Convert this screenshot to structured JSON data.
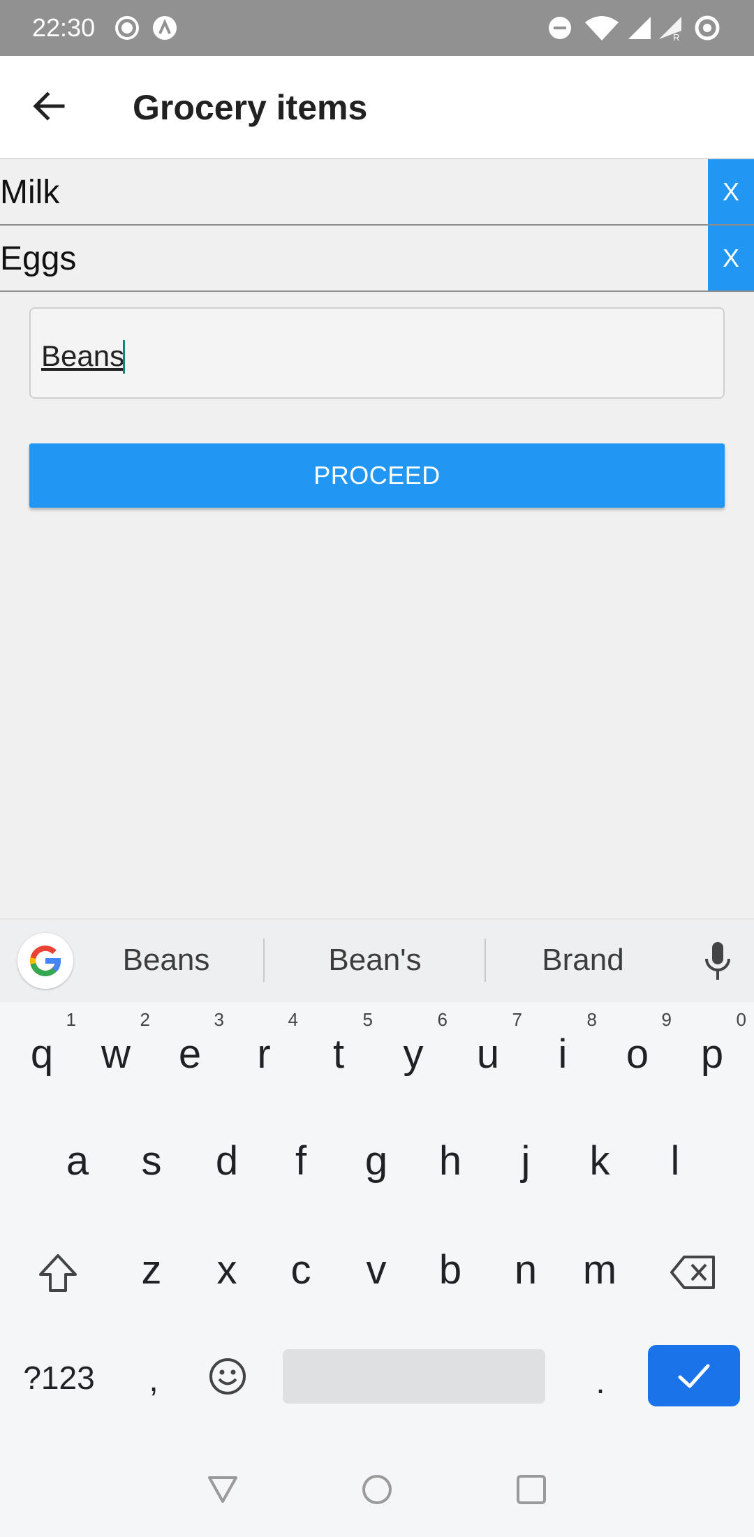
{
  "status_bar": {
    "time": "22:30",
    "icons": [
      "record-icon",
      "a-badge-icon",
      "dnd-icon",
      "wifi-icon",
      "signal-icon",
      "signal-roaming-icon",
      "ring-icon"
    ]
  },
  "app_bar": {
    "back_icon": "arrow-left-icon",
    "title": "Grocery items"
  },
  "list": {
    "items": [
      {
        "label": "Milk",
        "delete_label": "X"
      },
      {
        "label": "Eggs",
        "delete_label": "X"
      }
    ]
  },
  "input": {
    "value": "Beans"
  },
  "proceed_label": "PROCEED",
  "colors": {
    "accent": "#2196f3",
    "keyboard_enter": "#1a73e8",
    "status_bar": "#919191"
  },
  "keyboard": {
    "suggestions": [
      "Beans",
      "Bean's",
      "Brand"
    ],
    "row1": [
      {
        "key": "q",
        "num": "1"
      },
      {
        "key": "w",
        "num": "2"
      },
      {
        "key": "e",
        "num": "3"
      },
      {
        "key": "r",
        "num": "4"
      },
      {
        "key": "t",
        "num": "5"
      },
      {
        "key": "y",
        "num": "6"
      },
      {
        "key": "u",
        "num": "7"
      },
      {
        "key": "i",
        "num": "8"
      },
      {
        "key": "o",
        "num": "9"
      },
      {
        "key": "p",
        "num": "0"
      }
    ],
    "row2": [
      "a",
      "s",
      "d",
      "f",
      "g",
      "h",
      "j",
      "k",
      "l"
    ],
    "row3": [
      "z",
      "x",
      "c",
      "v",
      "b",
      "n",
      "m"
    ],
    "symbols_label": "?123",
    "comma": ",",
    "period": "."
  }
}
